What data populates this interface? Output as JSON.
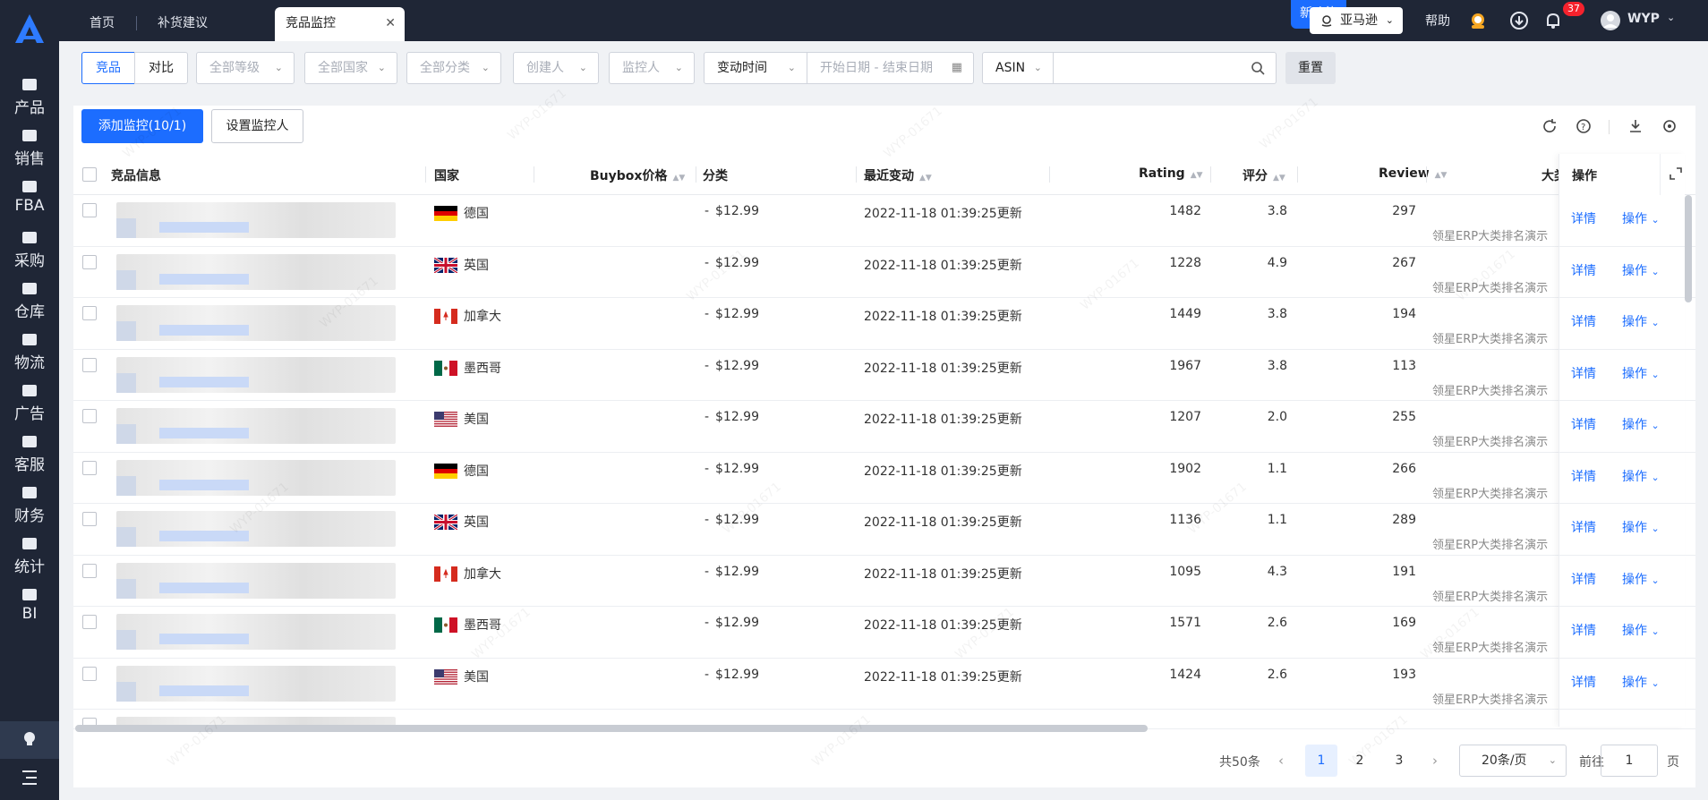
{
  "tabs": [
    {
      "label": "首页"
    },
    {
      "label": "补货建议"
    },
    {
      "label": "竞品监控",
      "close": "✕"
    }
  ],
  "topbar": {
    "new_feature": "新功能",
    "platform": "亚马逊",
    "help": "帮助",
    "badge_count": "37",
    "user": "WYP"
  },
  "sidebar": {
    "items": [
      {
        "label": "产品"
      },
      {
        "label": "销售"
      },
      {
        "label": "FBA"
      },
      {
        "label": "采购"
      },
      {
        "label": "仓库"
      },
      {
        "label": "物流"
      },
      {
        "label": "广告"
      },
      {
        "label": "客服"
      },
      {
        "label": "财务"
      },
      {
        "label": "统计"
      },
      {
        "label": "BI"
      }
    ]
  },
  "filters": {
    "seg_competitor": "竞品",
    "seg_compare": "对比",
    "level": "全部等级",
    "country": "全部国家",
    "category": "全部分类",
    "creator": "创建人",
    "monitor_person": "监控人",
    "change_time": "变动时间",
    "date_range": "开始日期 - 结束日期",
    "asin": "ASIN",
    "reset": "重置"
  },
  "actions": {
    "add_monitor": "添加监控(10/1)",
    "set_monitor": "设置监控人"
  },
  "table": {
    "headers": {
      "info": "竞品信息",
      "country": "国家",
      "buybox": "Buybox价格",
      "category": "分类",
      "last_change": "最近变动",
      "rating": "Rating",
      "score": "评分",
      "review": "Review",
      "big_cat": "大类",
      "ops": "操作"
    },
    "rows": [
      {
        "country": "德国",
        "flag": "de",
        "price": "$12.99",
        "category": "-",
        "changed": "2022-11-18 01:39:25更新",
        "rating": "1482",
        "score": "3.8",
        "review": "297",
        "rank": "领星ERP大类排名演示",
        "detail": "详情",
        "op": "操作"
      },
      {
        "country": "英国",
        "flag": "uk",
        "price": "$12.99",
        "category": "-",
        "changed": "2022-11-18 01:39:25更新",
        "rating": "1228",
        "score": "4.9",
        "review": "267",
        "rank": "领星ERP大类排名演示",
        "detail": "详情",
        "op": "操作"
      },
      {
        "country": "加拿大",
        "flag": "ca",
        "price": "$12.99",
        "category": "-",
        "changed": "2022-11-18 01:39:25更新",
        "rating": "1449",
        "score": "3.8",
        "review": "194",
        "rank": "领星ERP大类排名演示",
        "detail": "详情",
        "op": "操作"
      },
      {
        "country": "墨西哥",
        "flag": "mx",
        "price": "$12.99",
        "category": "-",
        "changed": "2022-11-18 01:39:25更新",
        "rating": "1967",
        "score": "3.8",
        "review": "113",
        "rank": "领星ERP大类排名演示",
        "detail": "详情",
        "op": "操作"
      },
      {
        "country": "美国",
        "flag": "us",
        "price": "$12.99",
        "category": "-",
        "changed": "2022-11-18 01:39:25更新",
        "rating": "1207",
        "score": "2.0",
        "review": "255",
        "rank": "领星ERP大类排名演示",
        "detail": "详情",
        "op": "操作"
      },
      {
        "country": "德国",
        "flag": "de",
        "price": "$12.99",
        "category": "-",
        "changed": "2022-11-18 01:39:25更新",
        "rating": "1902",
        "score": "1.1",
        "review": "266",
        "rank": "领星ERP大类排名演示",
        "detail": "详情",
        "op": "操作"
      },
      {
        "country": "英国",
        "flag": "uk",
        "price": "$12.99",
        "category": "-",
        "changed": "2022-11-18 01:39:25更新",
        "rating": "1136",
        "score": "1.1",
        "review": "289",
        "rank": "领星ERP大类排名演示",
        "detail": "详情",
        "op": "操作"
      },
      {
        "country": "加拿大",
        "flag": "ca",
        "price": "$12.99",
        "category": "-",
        "changed": "2022-11-18 01:39:25更新",
        "rating": "1095",
        "score": "4.3",
        "review": "191",
        "rank": "领星ERP大类排名演示",
        "detail": "详情",
        "op": "操作"
      },
      {
        "country": "墨西哥",
        "flag": "mx",
        "price": "$12.99",
        "category": "-",
        "changed": "2022-11-18 01:39:25更新",
        "rating": "1571",
        "score": "2.6",
        "review": "169",
        "rank": "领星ERP大类排名演示",
        "detail": "详情",
        "op": "操作"
      },
      {
        "country": "美国",
        "flag": "us",
        "price": "$12.99",
        "category": "-",
        "changed": "2022-11-18 01:39:25更新",
        "rating": "1424",
        "score": "2.6",
        "review": "193",
        "rank": "领星ERP大类排名演示",
        "detail": "详情",
        "op": "操作"
      }
    ]
  },
  "pagination": {
    "total": "共50条",
    "pages": [
      "1",
      "2",
      "3"
    ],
    "page_size": "20条/页",
    "goto_prefix": "前往",
    "goto_value": "1",
    "goto_suffix": "页"
  },
  "colors": {
    "sidebar_bg": "#1f2636",
    "primary": "#1c6dff",
    "badge": "#f5222d"
  }
}
